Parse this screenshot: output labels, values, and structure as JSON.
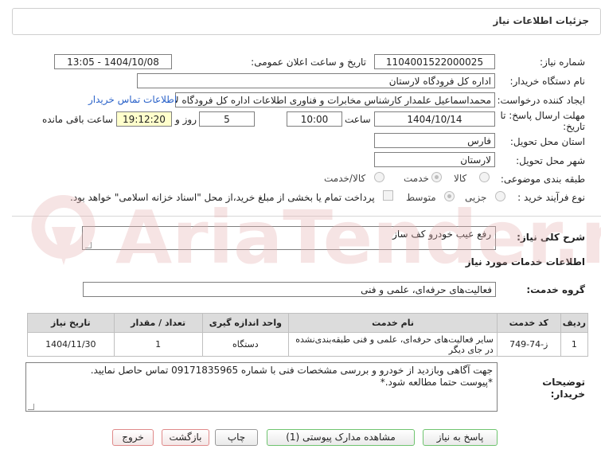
{
  "header": {
    "title": "جزئیات اطلاعات نیاز"
  },
  "form": {
    "need_number_label": "شماره نیاز:",
    "need_number": "1104001522000025",
    "announce_label": "تاریخ و ساعت اعلان عمومی:",
    "announce_value": "1404/10/08 - 13:05",
    "buyer_org_label": "نام دستگاه خریدار:",
    "buyer_org": "اداره کل فرودگاه لارستان",
    "creator_label": "ایجاد کننده درخواست:",
    "creator": "محمداسماعیل علمدار کارشناس مخابرات و فناوری اطلاعات اداره کل فرودگاه لارستان",
    "contact_link": "اطلاعات تماس خریدار",
    "deadline_label_line1": "مهلت ارسال پاسخ: تا",
    "deadline_label_line2": "تاریخ:",
    "deadline_date": "1404/10/14",
    "time_label": "ساعت",
    "deadline_time": "10:00",
    "days_value": "5",
    "days_and_label": "روز و",
    "remaining_time": "19:12:20",
    "remaining_label": "ساعت باقی مانده",
    "province_label": "استان محل تحویل:",
    "province": "فارس",
    "city_label": "شهر محل تحویل:",
    "city": "لارستان",
    "category_label": "طبقه بندی موضوعی:",
    "category_options": [
      "کالا",
      "خدمت",
      "کالا/خدمت"
    ],
    "process_label": "نوع فرآیند خرید :",
    "process_options": [
      "جزیی",
      "متوسط"
    ],
    "payment_note": "پرداخت تمام یا بخشی از مبلغ خرید،از محل \"اسناد خزانه اسلامی\" خواهد بود."
  },
  "summary": {
    "label": "شرح کلی نیاز:",
    "value": "رفع عیب خودرو کف ساز"
  },
  "services": {
    "section_title": "اطلاعات خدمات مورد نیاز",
    "group_label": "گروه خدمت:",
    "group_value": "فعالیت‌های حرفه‌ای، علمی و فنی",
    "table": {
      "headers": [
        "ردیف",
        "کد خدمت",
        "نام خدمت",
        "واحد اندازه گیری",
        "تعداد / مقدار",
        "تاریخ نیاز"
      ],
      "rows": [
        [
          "1",
          "ز-74-749",
          "سایر فعالیت‌های حرفه‌ای، علمی و فنی طبقه‌بندی‌نشده در جای دیگر",
          "دستگاه",
          "1",
          "1404/11/30"
        ]
      ]
    }
  },
  "notes": {
    "label_line1": "توضیحات",
    "label_line2": "خریدار:",
    "line1": "جهت آگاهی وبازدید از خودرو و بررسی مشخصات فنی با شماره 09171835965 تماس حاصل نمایید.",
    "line2": "*پیوست حتما مطالعه شود.*"
  },
  "buttons": {
    "respond": "پاسخ به نیاز",
    "attachments": "مشاهده مدارک پیوستی (1)",
    "print": "چاپ",
    "back": "بازگشت",
    "exit": "خروج"
  },
  "watermark": {
    "text": "AriaTender.net"
  },
  "colors": {
    "link": "#2a62c9",
    "highlight": "#ffffcc",
    "watermark": "#e6b3b3"
  }
}
